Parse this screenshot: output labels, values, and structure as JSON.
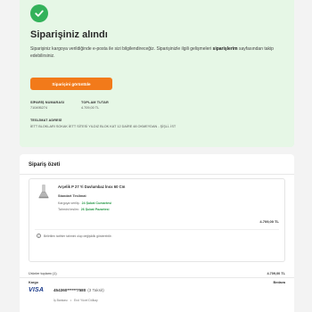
{
  "success": {
    "title": "Siparişiniz alındı",
    "desc_prefix": "Siparişiniz kargoya verildiğinde e-posta ile sizi bilgilendireceğiz. Siparişinizle ilgili gelişmeleri ",
    "desc_bold": "siparişlerim",
    "desc_suffix": " sayfasından takip edebilirsiniz.",
    "button_label": "Siparişini görüntüle",
    "order_no_label": "SİPARİŞ NUMARASI",
    "order_no": "710495274",
    "total_label": "TOPLAM TUTAR",
    "total": "4.709,00 TL",
    "address_label": "TESLİMAT ADRESİ",
    "address": "İETT BLOKLARI SOKAK İETT SİTESİ YILDIZ BLOK KAT 12 DAİRE 48 OKMEYDAN - ŞİŞLİ- İST"
  },
  "summary": {
    "title": "Sipariş özeti",
    "item": {
      "icon": "product-thumbnail",
      "name": "Arçelik P 27 Yi Davlumbaz İnox 60 Cm",
      "shipping_type": "Standart Teslimat",
      "shipped_label": "Kargoya veriliş:",
      "shipped_date": "24 Şubat Cumartesi",
      "delivery_label": "Tahmini teslim:",
      "delivery_date": "26 Şubat Pazartesi",
      "price": "4.709,00 TL",
      "note": "Belirtilen tarihler tahmini olup değişiklik gösterebilir."
    },
    "totals": {
      "products_label": "Ürünler toplamı (1)",
      "products_value": "4.709,00 TL",
      "shipping_label": "Kargo",
      "shipping_value": "Bedava"
    },
    "payment": {
      "brand": "VISA",
      "card_number": "454360******7580",
      "installments": "(3 Taksit)",
      "bank": "İş Bankası",
      "holder": "Erol Yücel Dölkay"
    }
  },
  "colors": {
    "success_bg": "#e6f7e6",
    "check": "#33b25a",
    "accent_orange": "#f27a1a",
    "date_green": "#2a9a4a",
    "visa_blue": "#1a3a8a"
  }
}
